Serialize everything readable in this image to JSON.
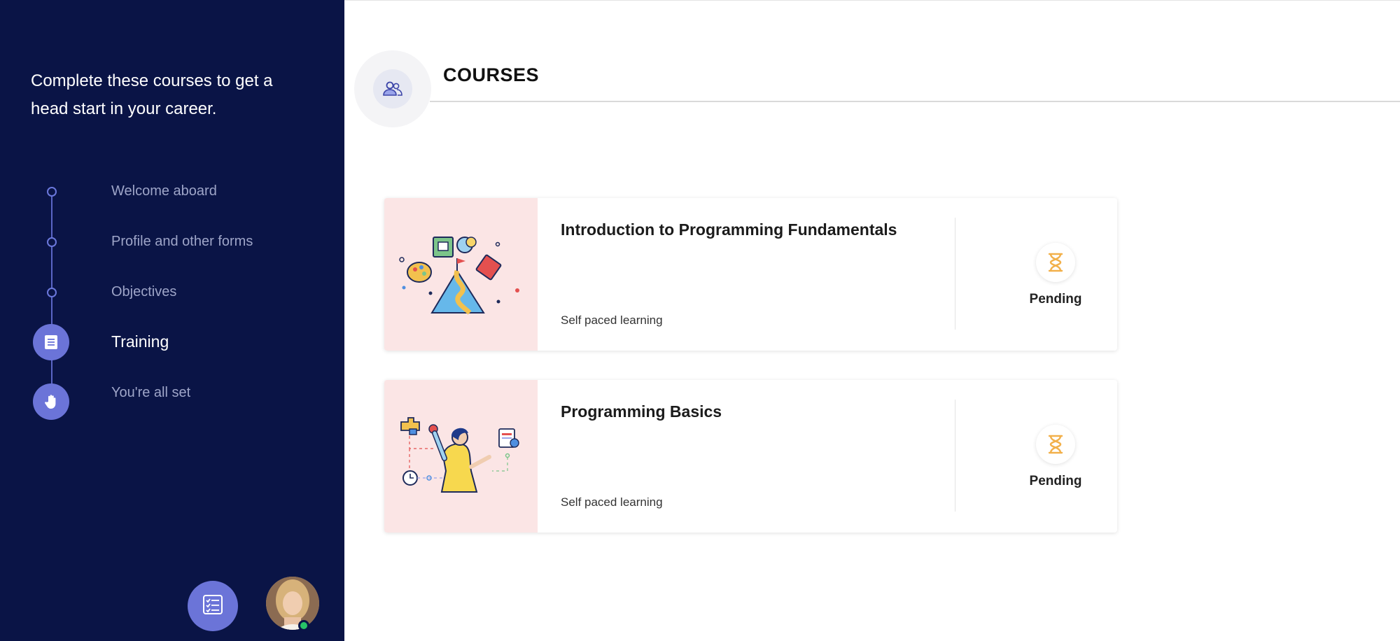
{
  "sidebar": {
    "intro_text": "Complete these courses to get a head start in your career.",
    "steps": [
      {
        "label": "Welcome aboard",
        "state": "done"
      },
      {
        "label": "Profile and other forms",
        "state": "done"
      },
      {
        "label": "Objectives",
        "state": "done"
      },
      {
        "label": "Training",
        "state": "active",
        "icon": "document-icon"
      },
      {
        "label": "You're all set",
        "state": "upcoming",
        "icon": "hand-wave-icon"
      }
    ],
    "actions": {
      "checklist_icon": "checklist-icon",
      "avatar": "user-avatar",
      "online_status_color": "#27c267"
    }
  },
  "header": {
    "title": "COURSES",
    "icon": "users-icon"
  },
  "courses": [
    {
      "title": "Introduction to Programming Fundamentals",
      "type": "Self paced learning",
      "status": "Pending",
      "status_icon": "hourglass-icon"
    },
    {
      "title": "Programming Basics",
      "type": "Self paced learning",
      "status": "Pending",
      "status_icon": "hourglass-icon"
    }
  ],
  "colors": {
    "sidebar_bg": "#0a1446",
    "accent": "#6b74d8",
    "thumb_bg": "#fbe5e5",
    "pending": "#f2b04a"
  }
}
